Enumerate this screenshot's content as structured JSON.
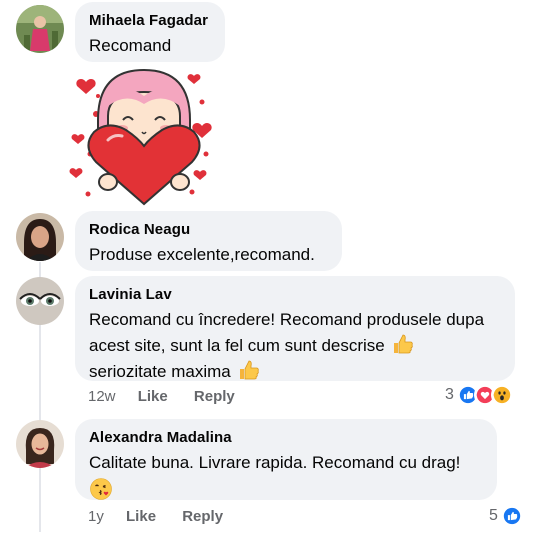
{
  "comments": [
    {
      "author": "Mihaela Fagadar",
      "text": "Recomand",
      "avatar_icon": "avatar-photo-child-outdoor",
      "sticker_icon": "girl-hugging-heart-sticker"
    },
    {
      "author": "Rodica Neagu",
      "text": "Produse excelente,recomand.",
      "avatar_icon": "avatar-photo-woman-dark-hair"
    },
    {
      "author": "Lavinia Lav",
      "line1": "Recomand cu încredere! Recomand produsele dupa",
      "line2": "acest site, sunt la fel cum  sunt descrise",
      "line3": "seriozitate maxima",
      "inline_emoji": "thumbs-up-emoji",
      "time": "12w",
      "like": "Like",
      "reply": "Reply",
      "reaction_count": "3",
      "reactions": [
        "like-reaction",
        "love-reaction",
        "wow-reaction"
      ],
      "avatar_icon": "avatar-photo-eyes-closeup"
    },
    {
      "author": "Alexandra Madalina",
      "text": "Calitate buna. Livrare rapida. Recomand cu drag!",
      "inline_emoji": "kissing-face-emoji",
      "time": "1y",
      "like": "Like",
      "reply": "Reply",
      "reaction_count": "5",
      "reactions": [
        "like-reaction"
      ],
      "avatar_icon": "avatar-photo-woman-smiling"
    }
  ],
  "colors": {
    "bubble": "#f0f2f5",
    "meta_text": "#65676b",
    "like_blue": "#1877f2",
    "love_red": "#f33e58",
    "wow_yellow": "#f7b125"
  }
}
